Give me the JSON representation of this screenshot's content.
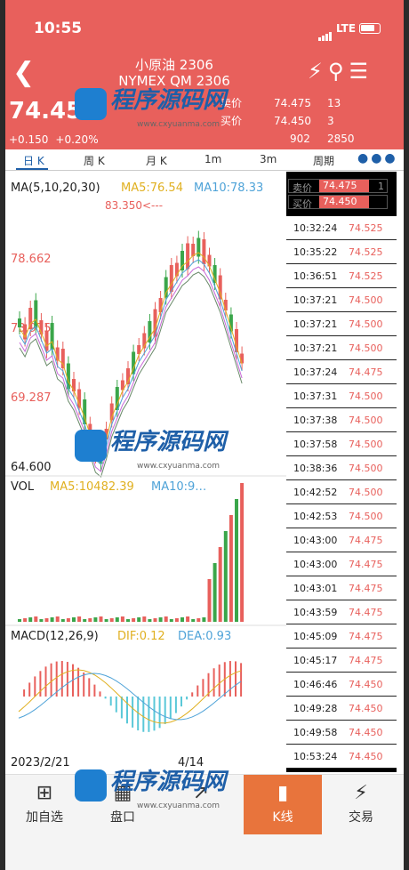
{
  "status": {
    "time": "10:55",
    "network": "LTE"
  },
  "header": {
    "title": "小原油 2306",
    "subtitle": "NYMEX QM 2306",
    "price": "74.45",
    "change": "+0.150",
    "change_pct": "+0.20%",
    "ask_label": "卖价",
    "ask_price": "74.475",
    "ask_qty": "13",
    "bid_label": "买价",
    "bid_price": "74.450",
    "bid_qty": "3",
    "vol": "902",
    "oi": "2850"
  },
  "tabs": [
    "日 K",
    "周 K",
    "月 K",
    "1m",
    "3m",
    "周期"
  ],
  "active_tab": "日 K",
  "chart_data": {
    "type": "candlestick",
    "ma_label": "MA(5,10,20,30)",
    "ma5": "MA5:76.54",
    "ma10": "MA10:78.33",
    "high_label": "83.350<---",
    "y_labels": [
      "78.662",
      "73.975",
      "69.287",
      "64.600"
    ],
    "vol_label": "VOL",
    "vol_ma5": "MA5:10482.39",
    "vol_ma10": "MA10:9…",
    "macd_label": "MACD(12,26,9)",
    "dif": "DIF:0.12",
    "dea": "DEA:0.93",
    "x_labels": [
      "2023/2/21",
      "4/14"
    ],
    "colors": {
      "up": "#e8605c",
      "down": "#3aa64a",
      "ma5": "#e0b020",
      "ma10": "#4fa3d8",
      "ma20": "#c86ad8",
      "ma30": "#6a8a6a"
    }
  },
  "ticks": {
    "ask_label": "卖价",
    "ask_price": "74.475",
    "ask_qty": "1",
    "bid_label": "买价",
    "bid_price": "74.450",
    "rows": [
      {
        "t": "10:32:24",
        "p": "74.525"
      },
      {
        "t": "10:35:22",
        "p": "74.525"
      },
      {
        "t": "10:36:51",
        "p": "74.525"
      },
      {
        "t": "10:37:21",
        "p": "74.500"
      },
      {
        "t": "10:37:21",
        "p": "74.500"
      },
      {
        "t": "10:37:21",
        "p": "74.500"
      },
      {
        "t": "10:37:24",
        "p": "74.475"
      },
      {
        "t": "10:37:31",
        "p": "74.500"
      },
      {
        "t": "10:37:38",
        "p": "74.500"
      },
      {
        "t": "10:37:58",
        "p": "74.500"
      },
      {
        "t": "10:38:36",
        "p": "74.500"
      },
      {
        "t": "10:42:52",
        "p": "74.500"
      },
      {
        "t": "10:42:53",
        "p": "74.500"
      },
      {
        "t": "10:43:00",
        "p": "74.475"
      },
      {
        "t": "10:43:00",
        "p": "74.475"
      },
      {
        "t": "10:43:01",
        "p": "74.475"
      },
      {
        "t": "10:43:59",
        "p": "74.475"
      },
      {
        "t": "10:45:09",
        "p": "74.475"
      },
      {
        "t": "10:45:17",
        "p": "74.475"
      },
      {
        "t": "10:46:46",
        "p": "74.450"
      },
      {
        "t": "10:49:28",
        "p": "74.450"
      },
      {
        "t": "10:49:58",
        "p": "74.450"
      },
      {
        "t": "10:53:24",
        "p": "74.450"
      }
    ]
  },
  "navbar": [
    "加自选",
    "盘口",
    "",
    "K线",
    "交易"
  ],
  "watermark": {
    "text": "程序源码网",
    "url": "www.cxyuanma.com"
  }
}
